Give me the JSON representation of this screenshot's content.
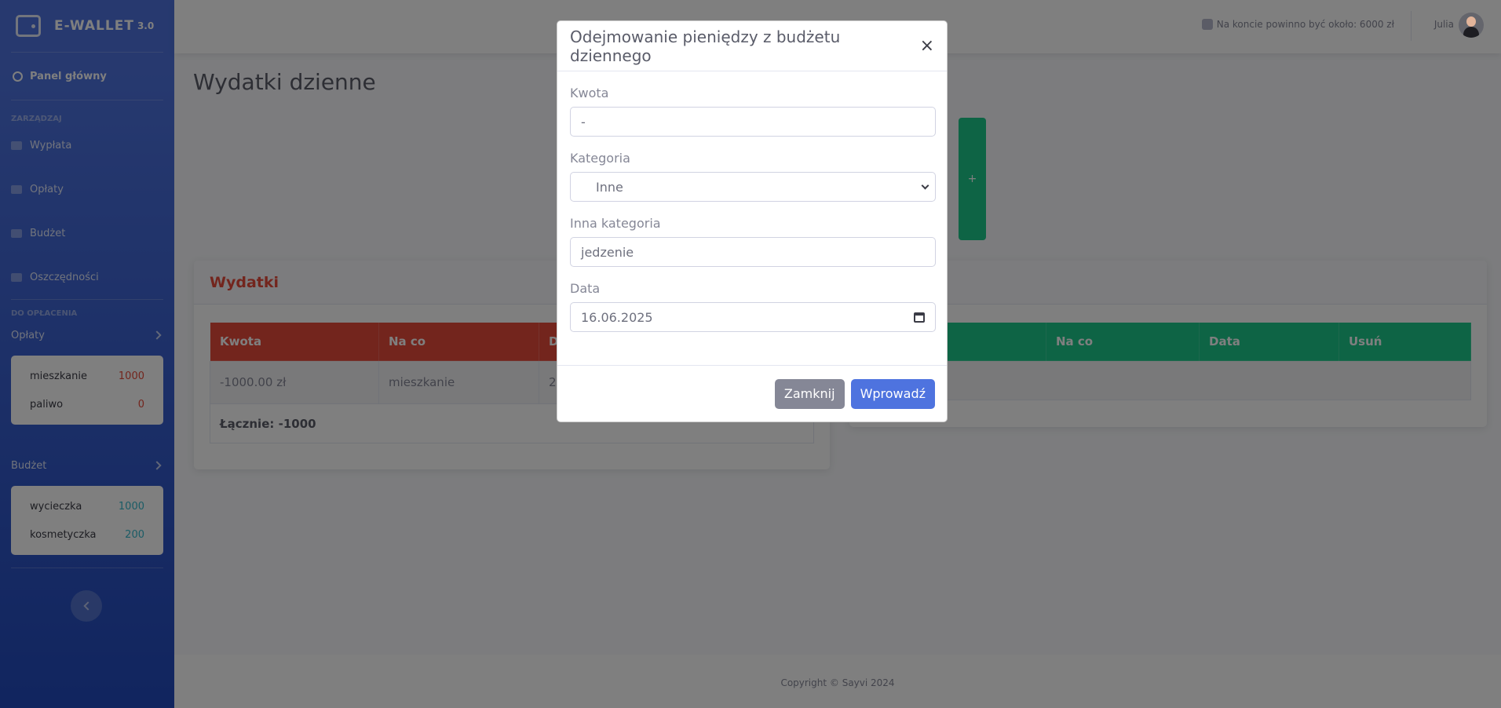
{
  "brand": {
    "name": "E-WALLET",
    "version": "3.0"
  },
  "sidebar": {
    "dashboard": "Panel główny",
    "manage_heading": "ZARZĄDZAJ",
    "items": [
      {
        "label": "Wypłata",
        "icon": "money-bag-icon"
      },
      {
        "label": "Opłaty",
        "icon": "hand-coins-icon"
      },
      {
        "label": "Budżet",
        "icon": "money-bill-icon"
      },
      {
        "label": "Oszczędności",
        "icon": "safe-icon"
      }
    ],
    "to_pay_heading": "DO OPŁACENIA",
    "fees_group": {
      "label": "Opłaty",
      "items": [
        {
          "name": "mieszkanie",
          "value": "1000"
        },
        {
          "name": "paliwo",
          "value": "0"
        }
      ]
    },
    "budget_group": {
      "label": "Budżet",
      "items": [
        {
          "name": "wycieczka",
          "value": "1000"
        },
        {
          "name": "kosmetyczka",
          "value": "200"
        }
      ]
    }
  },
  "topbar": {
    "account_message": "Na koncie powinno być około: 6000 zł",
    "user_name": "Julia"
  },
  "page": {
    "title": "Wydatki dzienne",
    "add_button": "+"
  },
  "expenses_card": {
    "title": "Wydatki",
    "columns": [
      "Kwota",
      "Na co",
      "D"
    ],
    "rows": [
      [
        "-1000.00 zł",
        "mieszkanie",
        "2"
      ]
    ],
    "total": "Łącznie: -1000"
  },
  "income_card": {
    "columns": [
      "",
      "Na co",
      "Data",
      "Usuń"
    ]
  },
  "footer": {
    "copyright": "Copyright © Sayvi 2024"
  },
  "modal": {
    "title": "Odejmowanie pieniędzy z budżetu dziennego",
    "close": "×",
    "amount_label": "Kwota",
    "amount_value": "-",
    "category_label": "Kategoria",
    "category_value": "Inne",
    "other_category_label": "Inna kategoria",
    "other_category_value": "jedzenie",
    "date_label": "Data",
    "date_value": "16.06.2025",
    "close_button": "Zamknij",
    "submit_button": "Wprowadź"
  },
  "colors": {
    "primary": "#4e73df",
    "danger": "#e74a3b",
    "success": "#1cc88a",
    "info": "#36b9cc",
    "secondary": "#858796"
  }
}
